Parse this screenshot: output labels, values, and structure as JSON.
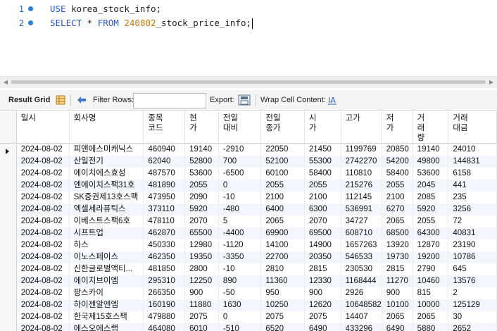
{
  "editor": {
    "lines": [
      {
        "number": "1",
        "kw1": "USE",
        "rest": " korea_stock_info;"
      },
      {
        "number": "2",
        "kw1": "SELECT",
        "star": " * ",
        "kw2": "FROM",
        "space": " ",
        "num": "240802",
        "rest": "_stock_price_info;"
      }
    ]
  },
  "toolbar": {
    "result_grid": "Result Grid",
    "filter_rows": "Filter Rows:",
    "filter_value": "",
    "export": "Export:",
    "wrap": "Wrap Cell Content:",
    "icons": [
      "grid-icon",
      "refresh-icon",
      "export-icon",
      "wrap-icon"
    ]
  },
  "grid": {
    "columns": [
      "일시",
      "회사명",
      "종목\n코드",
      "현\n가",
      "전일\n대비",
      "전일\n종가",
      "시\n가",
      "고가",
      "저\n가",
      "거\n래\n량",
      "거래\n대금"
    ],
    "rows": [
      [
        "2024-08-02",
        "피앤에스미캐닉스",
        "460940",
        "19140",
        "-2910",
        "22050",
        "21450",
        "1199769",
        "20850",
        "19140",
        "24010"
      ],
      [
        "2024-08-02",
        "산일전기",
        "62040",
        "52800",
        "700",
        "52100",
        "55300",
        "2742270",
        "54200",
        "49800",
        "144831"
      ],
      [
        "2024-08-02",
        "에이치에스효성",
        "487570",
        "53600",
        "-6500",
        "60100",
        "58400",
        "110810",
        "58400",
        "53600",
        "6158"
      ],
      [
        "2024-08-02",
        "엔에이치스팩31호",
        "481890",
        "2055",
        "0",
        "2055",
        "2055",
        "215276",
        "2055",
        "2045",
        "441"
      ],
      [
        "2024-08-02",
        "SK증권제13호스팩",
        "473950",
        "2090",
        "-10",
        "2100",
        "2100",
        "112145",
        "2100",
        "2085",
        "235"
      ],
      [
        "2024-08-02",
        "엑셀세라퓨틱스",
        "373110",
        "5920",
        "-480",
        "6400",
        "6300",
        "536991",
        "6270",
        "5920",
        "3256"
      ],
      [
        "2024-08-02",
        "이베스트스팩6호",
        "478110",
        "2070",
        "5",
        "2065",
        "2070",
        "34727",
        "2065",
        "2055",
        "72"
      ],
      [
        "2024-08-02",
        "시프트업",
        "462870",
        "65500",
        "-4400",
        "69900",
        "69500",
        "608710",
        "68500",
        "64300",
        "40831"
      ],
      [
        "2024-08-02",
        "하스",
        "450330",
        "12980",
        "-1120",
        "14100",
        "14900",
        "1657263",
        "13920",
        "12870",
        "23190"
      ],
      [
        "2024-08-02",
        "이노스페이스",
        "462350",
        "19350",
        "-3350",
        "22700",
        "20350",
        "546533",
        "19730",
        "19200",
        "10786"
      ],
      [
        "2024-08-02",
        "신한글로벌액티...",
        "481850",
        "2800",
        "-10",
        "2810",
        "2815",
        "230530",
        "2815",
        "2790",
        "645"
      ],
      [
        "2024-08-02",
        "에이치브이엠",
        "295310",
        "12250",
        "890",
        "11360",
        "12330",
        "1168444",
        "11270",
        "10460",
        "13576"
      ],
      [
        "2024-08-02",
        "팡스카이",
        "266350",
        "900",
        "-50",
        "950",
        "900",
        "2926",
        "900",
        "815",
        "2"
      ],
      [
        "2024-08-02",
        "하이젠알앤엠",
        "160190",
        "11880",
        "1630",
        "10250",
        "12620",
        "10648582",
        "10100",
        "10000",
        "125129"
      ],
      [
        "2024-08-02",
        "한국제15호스팩",
        "479880",
        "2075",
        "0",
        "2075",
        "2075",
        "14407",
        "2065",
        "2065",
        "30"
      ],
      [
        "2024-08-02",
        "에스오에스랩",
        "464080",
        "6010",
        "-510",
        "6520",
        "6490",
        "433296",
        "6490",
        "5880",
        "2652"
      ]
    ]
  }
}
